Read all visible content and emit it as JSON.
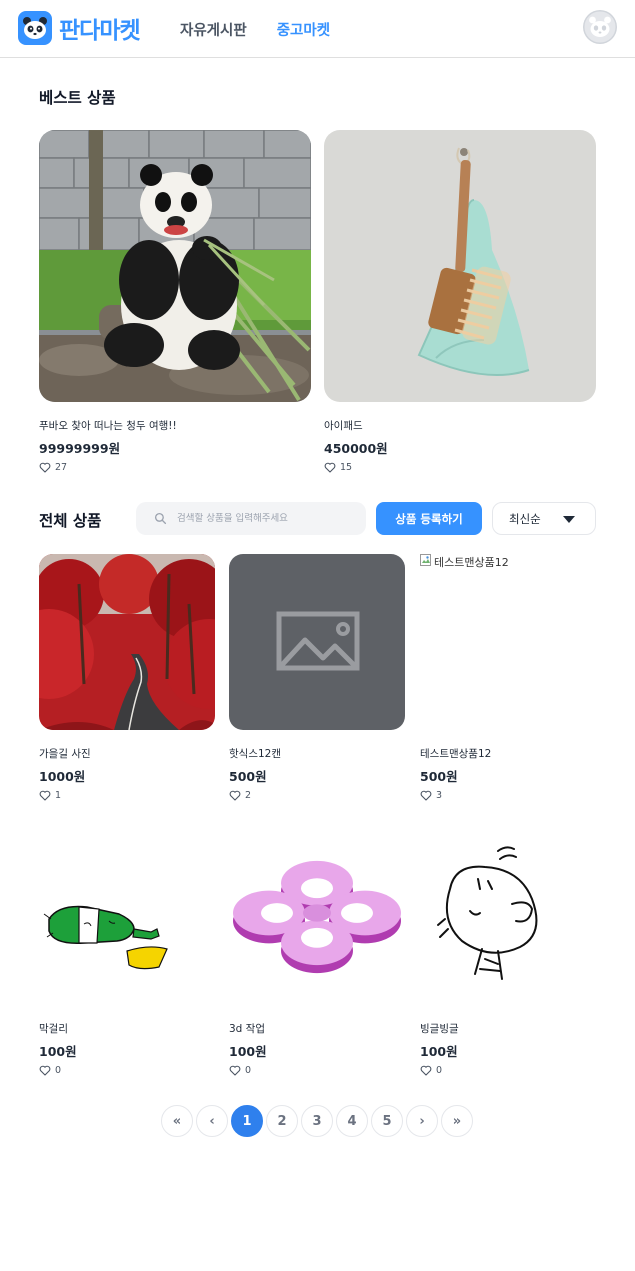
{
  "header": {
    "logo_text": "판다마켓",
    "nav": [
      {
        "label": "자유게시판",
        "active": false
      },
      {
        "label": "중고마켓",
        "active": true
      }
    ]
  },
  "best": {
    "title": "베스트 상품",
    "items": [
      {
        "name": "푸바오 찾아 떠나는 청두 여행!!",
        "price": "99999999원",
        "favorites": "27"
      },
      {
        "name": "아이패드",
        "price": "450000원",
        "favorites": "15"
      }
    ]
  },
  "all": {
    "title": "전체 상품",
    "search_placeholder": "검색할 상품을 입력해주세요",
    "register_label": "상품 등록하기",
    "sort_label": "최신순",
    "items": [
      {
        "name": "가을길 사진",
        "price": "1000원",
        "favorites": "1"
      },
      {
        "name": "핫식스12캔",
        "price": "500원",
        "favorites": "2"
      },
      {
        "name": "테스트맨상품12",
        "price": "500원",
        "favorites": "3",
        "broken_alt": "테스트맨상품12"
      },
      {
        "name": "막걸리",
        "price": "100원",
        "favorites": "0"
      },
      {
        "name": "3d 작업",
        "price": "100원",
        "favorites": "0"
      },
      {
        "name": "빙글빙글",
        "price": "100원",
        "favorites": "0"
      }
    ]
  },
  "pagination": {
    "first": "«",
    "prev": "‹",
    "pages": [
      "1",
      "2",
      "3",
      "4",
      "5"
    ],
    "current": "1",
    "next": "›",
    "last": "»"
  },
  "colors": {
    "brand": "#3692FF",
    "active_page": "#2F80ED"
  }
}
